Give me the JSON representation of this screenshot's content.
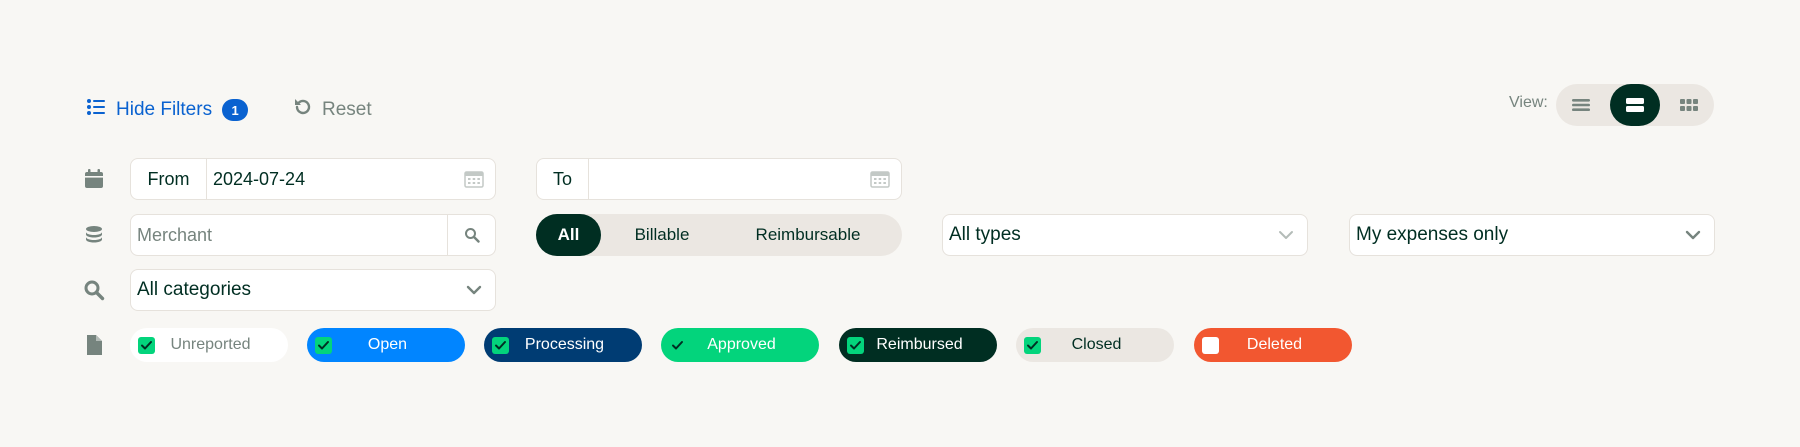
{
  "header": {
    "hide_filters_label": "Hide Filters",
    "filter_count": "1",
    "reset_label": "Reset",
    "view_label": "View:",
    "view_modes": [
      "list",
      "table",
      "grid"
    ],
    "active_view": "table"
  },
  "date_filter": {
    "from_label": "From",
    "from_value": "2024-07-24",
    "to_label": "To",
    "to_value": ""
  },
  "merchant": {
    "placeholder": "Merchant"
  },
  "expense_segment": {
    "options": [
      "All",
      "Billable",
      "Reimbursable"
    ],
    "selected": "All"
  },
  "type_select": {
    "value": "All types"
  },
  "owner_select": {
    "value": "My expenses only"
  },
  "category_select": {
    "value": "All categories"
  },
  "statuses": [
    {
      "label": "Unreported",
      "checked": true,
      "bg": "#ffffff",
      "fg": "#76847e"
    },
    {
      "label": "Open",
      "checked": true,
      "bg": "#0185ff",
      "fg": "#ffffff"
    },
    {
      "label": "Processing",
      "checked": true,
      "bg": "#003c73",
      "fg": "#ffffff"
    },
    {
      "label": "Approved",
      "checked": true,
      "bg": "#03d47c",
      "fg": "#ffffff"
    },
    {
      "label": "Reimbursed",
      "checked": true,
      "bg": "#002e22",
      "fg": "#ffffff"
    },
    {
      "label": "Closed",
      "checked": true,
      "bg": "#ebe7e2",
      "fg": "#002e22"
    },
    {
      "label": "Deleted",
      "checked": false,
      "bg": "#f25730",
      "fg": "#ffffff"
    }
  ],
  "colors": {
    "accent": "#0a62d0",
    "dark_green": "#002e22",
    "muted": "#76847e",
    "check_green": "#03d47c"
  }
}
